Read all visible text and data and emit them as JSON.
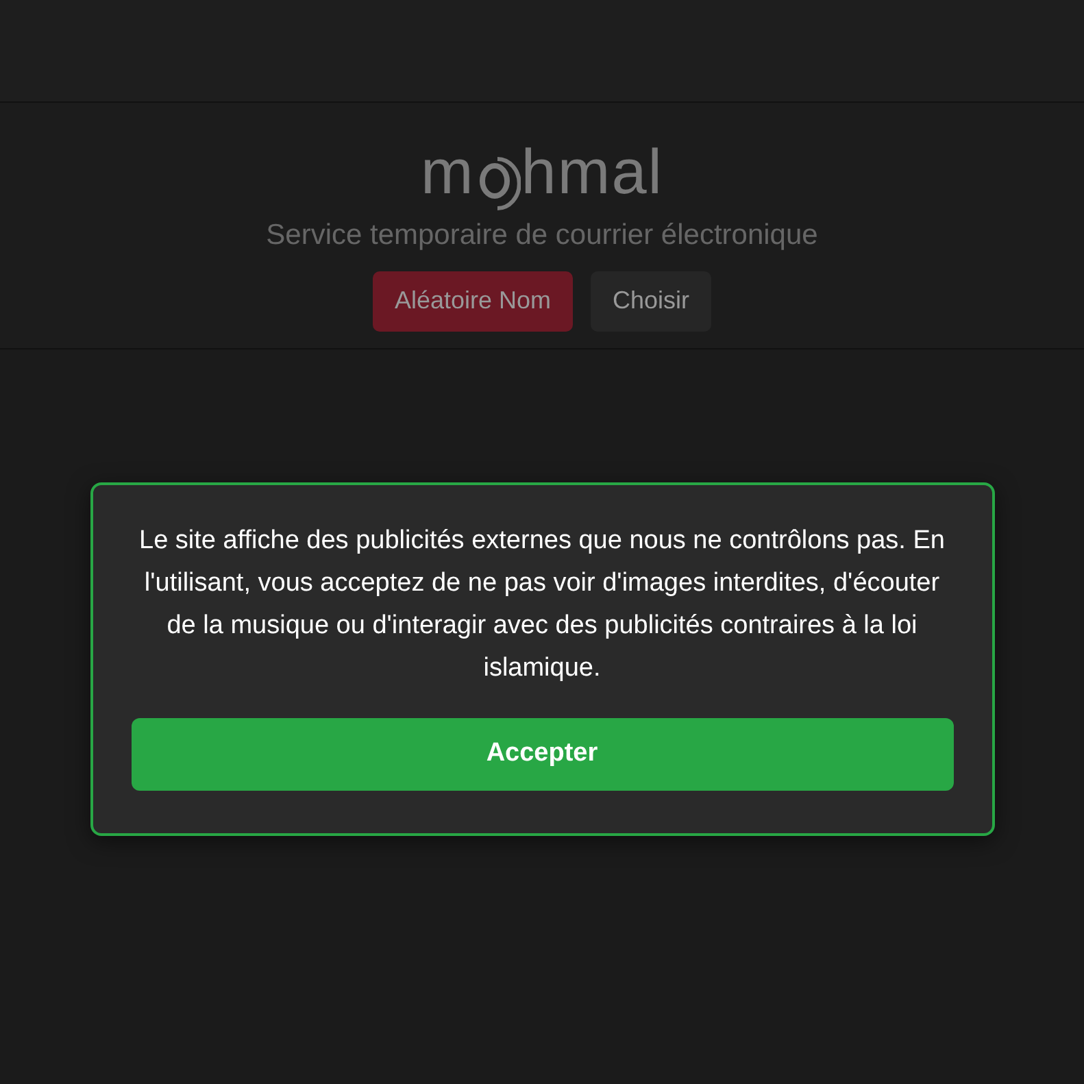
{
  "logo": {
    "before": "m",
    "after": "hmal"
  },
  "tagline": "Service temporaire de courrier électronique",
  "header_buttons": [
    {
      "label": "Aléatoire Nom",
      "kind": "primary"
    },
    {
      "label": "Choisir",
      "kind": "secondary"
    }
  ],
  "notice": {
    "message": "Le site affiche des publicités externes que nous ne contrôlons pas. En l'utilisant, vous acceptez de ne pas voir d'images interdites, d'écouter de la musique ou d'interagir avec des publicités contraires à la loi islamique.",
    "button": "Accepter"
  }
}
